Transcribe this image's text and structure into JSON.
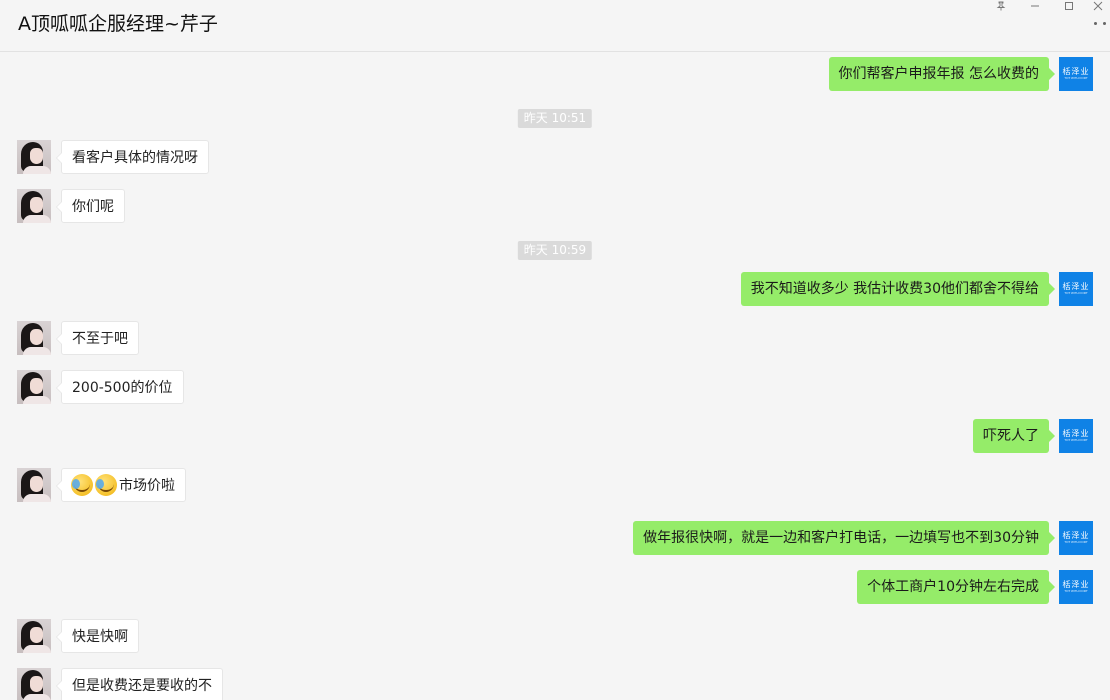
{
  "window": {
    "title": "A顶呱呱企服经理~芹子",
    "pin_icon": "pin-icon",
    "minimize_icon": "minimize-icon",
    "maximize_icon": "maximize-icon",
    "close_icon": "close-icon"
  },
  "brand_avatar": {
    "line1": "栝泽业",
    "line2": "TOT WITH FORT"
  },
  "messages": [
    {
      "type": "msg",
      "side": "right",
      "text": "你们帮客户申报年报 怎么收费的"
    },
    {
      "type": "time",
      "text": "昨天 10:51"
    },
    {
      "type": "msg",
      "side": "left",
      "text": "看客户具体的情况呀"
    },
    {
      "type": "msg",
      "side": "left",
      "text": "你们呢"
    },
    {
      "type": "time",
      "text": "昨天 10:59"
    },
    {
      "type": "msg",
      "side": "right",
      "text": "我不知道收多少 我估计收费30他们都舍不得给"
    },
    {
      "type": "msg",
      "side": "left",
      "text": "不至于吧"
    },
    {
      "type": "msg",
      "side": "left",
      "text": "200-500的价位"
    },
    {
      "type": "msg",
      "side": "right",
      "text": "吓死人了"
    },
    {
      "type": "msg",
      "side": "left",
      "text": "市场价啦",
      "emoji": "laugh-cry-emoji"
    },
    {
      "type": "msg",
      "side": "right",
      "text": "做年报很快啊，就是一边和客户打电话，一边填写也不到30分钟"
    },
    {
      "type": "msg",
      "side": "right",
      "text": "个体工商户10分钟左右完成"
    },
    {
      "type": "msg",
      "side": "left",
      "text": "快是快啊"
    },
    {
      "type": "msg",
      "side": "left",
      "text": "但是收费还是要收的不"
    }
  ]
}
